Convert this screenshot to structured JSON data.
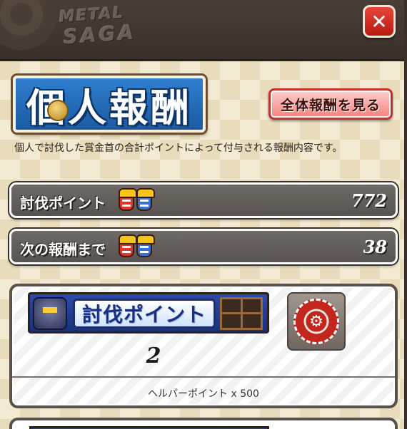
{
  "header": {
    "logo_line1": "METAL",
    "logo_line2": "SAGA",
    "close_label": "✕"
  },
  "page": {
    "title": "個人報酬",
    "view_all_button": "全体報酬を見る",
    "description": "個人で討伐した賞金首の合計ポイントによって付与される報酬内容です。"
  },
  "stats": [
    {
      "label": "討伐ポイント",
      "value": "772"
    },
    {
      "label": "次の報酬まで",
      "value": "38"
    }
  ],
  "reward": {
    "banner_label": "討伐ポイント",
    "threshold": "2",
    "emblem_symbol": "⚙",
    "reward_text": "ヘルパーポイント x 500"
  },
  "colors": {
    "header_bg": "#3a302a",
    "title_blue": "#1b5aa2",
    "button_pink": "#f3817c",
    "close_red": "#c62a1f",
    "stat_gray": "#5f5a56"
  }
}
